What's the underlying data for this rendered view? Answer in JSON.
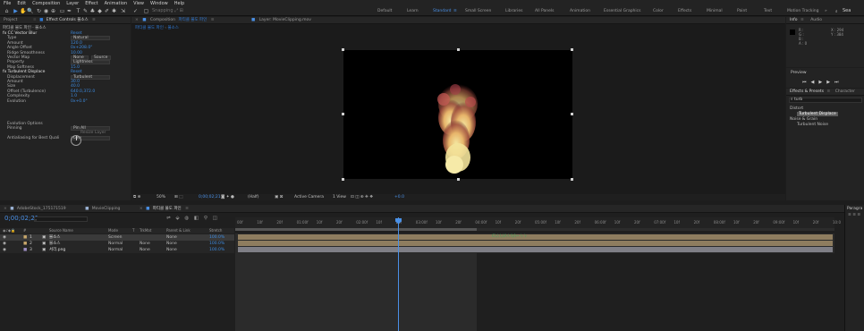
{
  "menu": [
    "File",
    "Edit",
    "Composition",
    "Layer",
    "Effect",
    "Animation",
    "View",
    "Window",
    "Help"
  ],
  "toolbar": {
    "snapping_label": "Snapping",
    "workspaces": [
      "Default",
      "Learn",
      "Standard",
      "Small Screen",
      "Libraries",
      "All Panels",
      "Animation",
      "Essential Graphics",
      "Color",
      "Effects",
      "Minimal",
      "Paint",
      "Text",
      "Motion Tracking"
    ],
    "active_workspace": "Standard",
    "search_label": "Sea"
  },
  "effect_controls": {
    "tabs": [
      "Project",
      "Effect Controls 불소스"
    ],
    "layer_path": "파티클 불도 파인 · 불소스",
    "rows": [
      {
        "label": "fx  CC Vector Blur",
        "value": "Reset",
        "type": "header"
      },
      {
        "label": "Type",
        "value": "Natural",
        "type": "dropdown"
      },
      {
        "label": "Amount",
        "value": "120.0",
        "type": "value"
      },
      {
        "label": "Angle Offset",
        "value": "0x+208.0°",
        "type": "value"
      },
      {
        "label": "Ridge Smoothness",
        "value": "10.00",
        "type": "value"
      },
      {
        "label": "Vector Map",
        "value": "None",
        "value2": "Source",
        "type": "dropdown2"
      },
      {
        "label": "Property",
        "value": "Lightness",
        "type": "dropdown"
      },
      {
        "label": "Map Softness",
        "value": "15.0",
        "type": "value"
      },
      {
        "label": "fx  Turbulent Displace",
        "value": "Reset",
        "type": "header"
      },
      {
        "label": "Displacement",
        "value": "Turbulent",
        "type": "dropdown"
      },
      {
        "label": "Amount",
        "value": "30.0",
        "type": "value"
      },
      {
        "label": "Size",
        "value": "40.0",
        "type": "value"
      },
      {
        "label": "Offset (Turbulence)",
        "value": "640.0,372.0",
        "type": "value"
      },
      {
        "label": "Complexity",
        "value": "1.0",
        "type": "value"
      },
      {
        "label": "Evolution",
        "value": "0x+0.0°",
        "type": "value"
      },
      {
        "label": "Evolution Options",
        "value": "",
        "type": "value"
      },
      {
        "label": "Pinning",
        "value": "Pin All",
        "type": "dropdown"
      },
      {
        "label": "",
        "value": "Resize Layer",
        "type": "checkbox"
      },
      {
        "label": "Antialiasing for Best Quali",
        "value": "Low",
        "type": "dropdown"
      }
    ]
  },
  "composition": {
    "tab_label": "Composition",
    "comp_name": "파티클 불도 파인",
    "layer_tab": "Layer: MovieClipping.mov",
    "breadcrumb": [
      "파티클 불도 파인",
      "불소스"
    ],
    "footer": {
      "zoom": "50%",
      "timecode": "0;00;02;21",
      "resolution": "(Half)",
      "camera": "Active Camera",
      "view": "1 View",
      "exposure": "+0.0"
    }
  },
  "right_panel": {
    "info_tabs": [
      "Info",
      "Audio"
    ],
    "info": {
      "x": "X : 294",
      "y": "Y : 384",
      "r": "R :",
      "g": "G :",
      "b": "B :",
      "a": "A : 0"
    },
    "preview_label": "Preview",
    "effects_tabs": [
      "Effects & Presets",
      "Character"
    ],
    "search_value": "turb",
    "tree": [
      {
        "label": "Distort",
        "indent": 0
      },
      {
        "label": "Turbulent Displace",
        "indent": 1,
        "selected": true
      },
      {
        "label": "Noise & Grain",
        "indent": 0
      },
      {
        "label": "Turbulent Noise",
        "indent": 1,
        "selected": false
      }
    ]
  },
  "timeline": {
    "tabs": [
      "AdobeStock_175171519",
      "MovieClipping",
      "파티클 불도 파인"
    ],
    "timecode": "0;00;02;21",
    "columns": [
      "Source Name",
      "Mode",
      "T",
      "TrkMat",
      "Parent & Link",
      "Stretch"
    ],
    "layers": [
      {
        "num": "1",
        "name": "불소스",
        "mode": "Screen",
        "trkmat": "",
        "parent": "None",
        "stretch": "100.0%",
        "color": "#c9a86b",
        "selected": true
      },
      {
        "num": "2",
        "name": "불소스",
        "mode": "Normal",
        "trkmat": "None",
        "parent": "None",
        "stretch": "100.0%",
        "color": "#c9a86b",
        "selected": false
      },
      {
        "num": "3",
        "name": "서리.png",
        "mode": "Normal",
        "trkmat": "None",
        "parent": "None",
        "stretch": "100.0%",
        "color": "#9d8ec4",
        "selected": false
      }
    ],
    "ruler": [
      "00f",
      "10f",
      "20f",
      "01:00f",
      "10f",
      "20f",
      "02:00f",
      "10f",
      "20f",
      "03:00f",
      "10f",
      "20f",
      "04:00f",
      "10f",
      "20f",
      "05:00f",
      "10f",
      "20f",
      "06:00f",
      "10f",
      "20f",
      "07:00f",
      "10f",
      "20f",
      "08:00f",
      "10f",
      "20f",
      "09:00f",
      "10f",
      "20f",
      "10:0"
    ],
    "paragraph_tab": "Paragra"
  },
  "colors": {
    "accent": "#4a90e6",
    "value_blue": "#3d8be0",
    "layer_bar": "#9c8b6e",
    "playhead": "#4a90e6",
    "work_area": "#3a3a3a"
  }
}
